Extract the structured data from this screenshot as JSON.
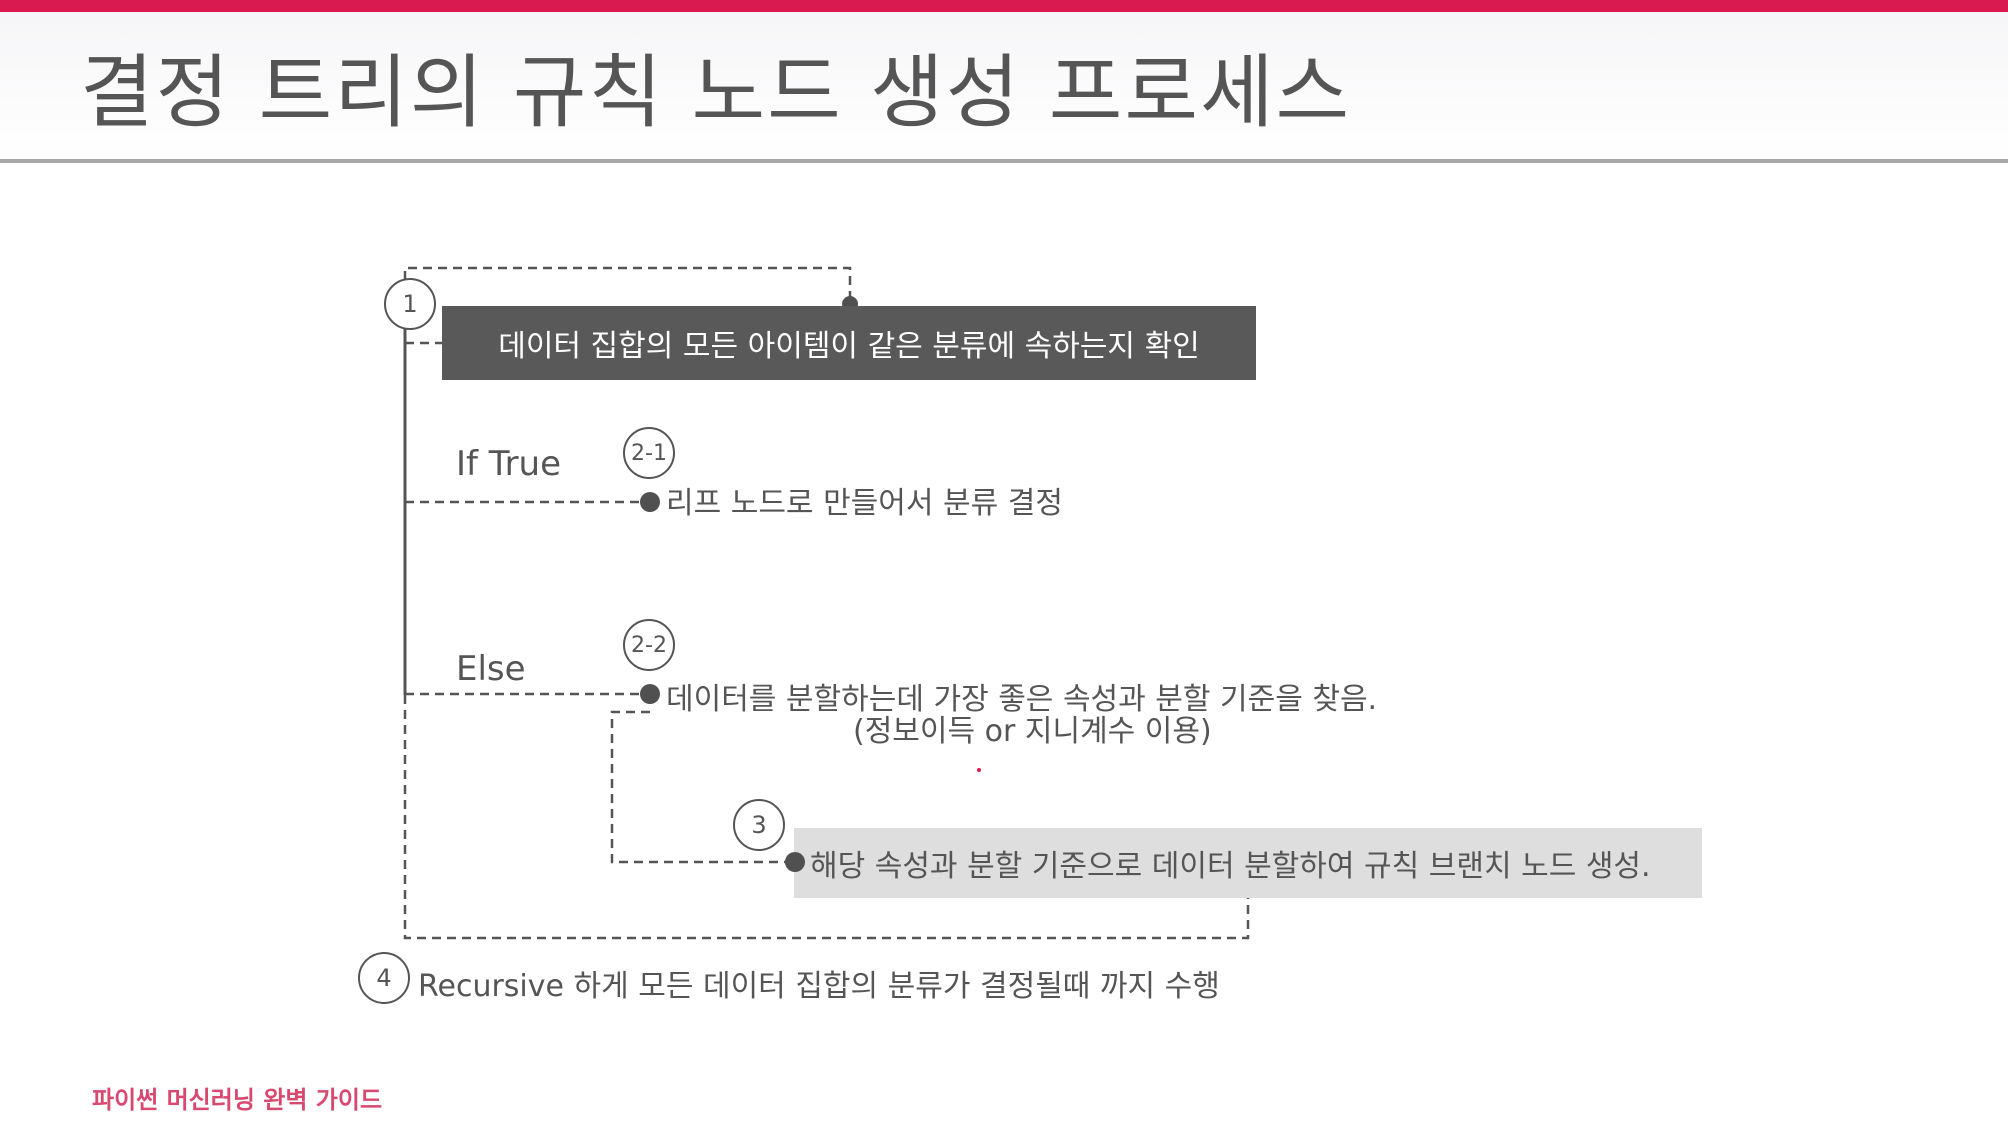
{
  "title": "결정 트리의 규칙 노드 생성 프로세스",
  "colors": {
    "accent": "#d91a50",
    "dark_box": "#595959",
    "light_box": "#dedede",
    "footer_text": "#d9486f"
  },
  "steps": {
    "step1": {
      "number": "1",
      "text": "데이터 집합의 모든 아이템이 같은 분류에 속하는지 확인"
    },
    "step2_1": {
      "number": "2-1",
      "branch_label": "If True",
      "text": "리프  노드로 만들어서 분류 결정"
    },
    "step2_2": {
      "number": "2-2",
      "branch_label": "Else",
      "text": "데이터를 분할하는데 가장 좋은 속성과 분할 기준을 찾음.",
      "subtext": "(정보이득 or 지니계수 이용)"
    },
    "step3": {
      "number": "3",
      "text": "해당 속성과 분할 기준으로 데이터 분할하여 규칙 브랜치 노드 생성."
    },
    "step4": {
      "number": "4",
      "text": "Recursive 하게 모든 데이터 집합의 분류가 결정될때 까지 수행"
    }
  },
  "footer": {
    "brand": "파이썬 머신러닝 완벽 가이드"
  }
}
